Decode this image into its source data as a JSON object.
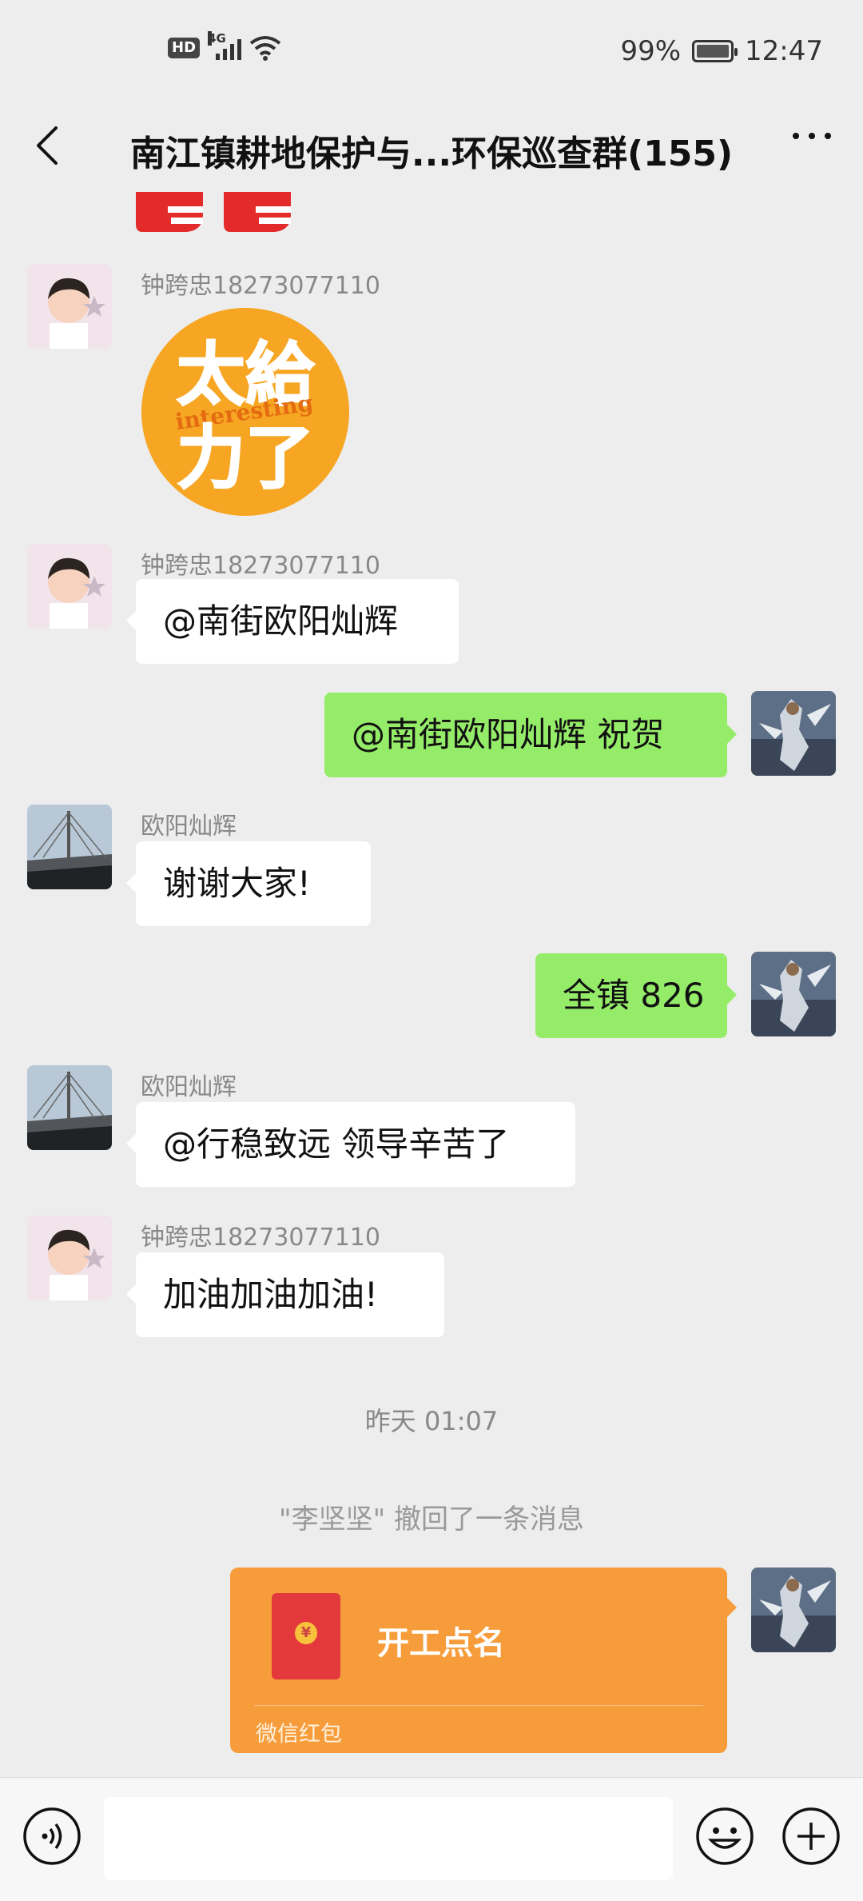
{
  "status_bar": {
    "hd_badge": "HD",
    "network": "4G",
    "battery_percent": "99%",
    "time": "12:47"
  },
  "header": {
    "title": "南江镇耕地保护与...环保巡查群(155)",
    "back_icon": "chevron-left-icon",
    "more_icon": "more-dots-icon"
  },
  "messages": [
    {
      "type": "sticker",
      "side": "left",
      "sender": "钟跨忠18273077110",
      "sticker_text_1": "太給",
      "sticker_text_2": "力了",
      "sticker_text_3": "interesting"
    },
    {
      "type": "text",
      "side": "left",
      "sender": "钟跨忠18273077110",
      "text": "@南街欧阳灿辉"
    },
    {
      "type": "text",
      "side": "right",
      "text": "@南街欧阳灿辉  祝贺"
    },
    {
      "type": "text",
      "side": "left",
      "sender": "欧阳灿辉",
      "text": "谢谢大家!"
    },
    {
      "type": "text",
      "side": "right",
      "text": "全镇 826"
    },
    {
      "type": "text",
      "side": "left",
      "sender": "欧阳灿辉",
      "text": "@行稳致远  领导辛苦了"
    },
    {
      "type": "text",
      "side": "left",
      "sender": "钟跨忠18273077110",
      "text": "加油加油加油!"
    }
  ],
  "timestamp": "昨天 01:07",
  "system_message": "\"李坚坚\" 撤回了一条消息",
  "red_packet": {
    "title": "开工点名",
    "footer": "微信红包",
    "coin_symbol": "¥",
    "color": "#f79c3b"
  },
  "input_bar": {
    "voice_icon": "voice-icon",
    "emoji_icon": "emoji-icon",
    "add_icon": "plus-circle-icon"
  },
  "colors": {
    "background": "#ededed",
    "outgoing_bubble": "#95ec69",
    "incoming_bubble": "#ffffff"
  }
}
